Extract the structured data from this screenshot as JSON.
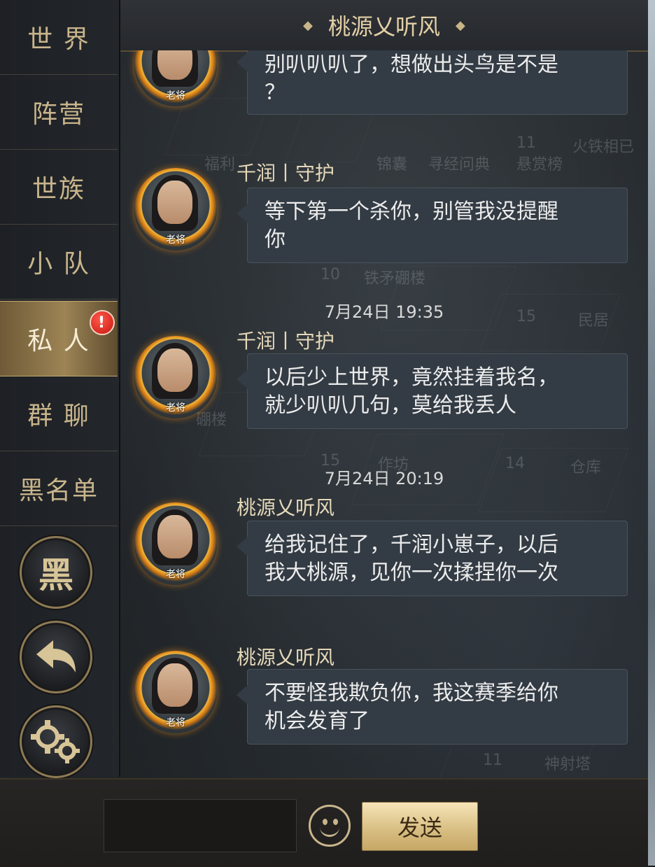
{
  "header": {
    "title": "桃源乂听风"
  },
  "sidebar": {
    "tabs": [
      {
        "label": "世 界"
      },
      {
        "label": "阵营"
      },
      {
        "label": "世族"
      },
      {
        "label": "小 队"
      },
      {
        "label": "私 人"
      },
      {
        "label": "群 聊"
      },
      {
        "label": "黑名单"
      }
    ],
    "active_tab": "私 人",
    "alert_badge": "!",
    "blacklist_button_label": "黑"
  },
  "map_labels": [
    "福利",
    "锦囊",
    "寻经问典",
    "悬赏榜",
    "火铁相已",
    "10",
    "铁矛硼楼",
    "15",
    "民居",
    "硼楼",
    "15",
    "作坊",
    "14",
    "仓库",
    "11",
    "神射塔",
    "11"
  ],
  "messages": [
    {
      "avatar_tag": "老将",
      "bubble_lines": [
        "别叭叭叭了，想做出头鸟是不是",
        "？"
      ]
    },
    {
      "sender": "千润丨守护",
      "avatar_tag": "老将",
      "bubble_lines": [
        "等下第一个杀你，别管我没提醒",
        "你"
      ]
    },
    {
      "timestamp": "7月24日 19:35"
    },
    {
      "sender": "千润丨守护",
      "avatar_tag": "老将",
      "bubble_lines": [
        "以后少上世界，竟然挂着我名，",
        "就少叭叭几句，莫给我丢人"
      ]
    },
    {
      "timestamp": "7月24日 20:19"
    },
    {
      "sender": "桃源乂听风",
      "avatar_tag": "老将",
      "bubble_lines": [
        "给我记住了，千润小崽子，以后",
        "我大桃源，见你一次揉捏你一次"
      ]
    },
    {
      "sender": "桃源乂听风",
      "avatar_tag": "老将",
      "bubble_lines": [
        "不要怪我欺负你，我这赛季给你",
        "机会发育了"
      ]
    }
  ],
  "input": {
    "value": "",
    "placeholder": ""
  },
  "send_button_label": "发送",
  "colors": {
    "accent_gold": "#c9b58c",
    "bubble_bg": "#333b44",
    "active_tab": "#9c8455",
    "alert_red": "#d81e14"
  }
}
